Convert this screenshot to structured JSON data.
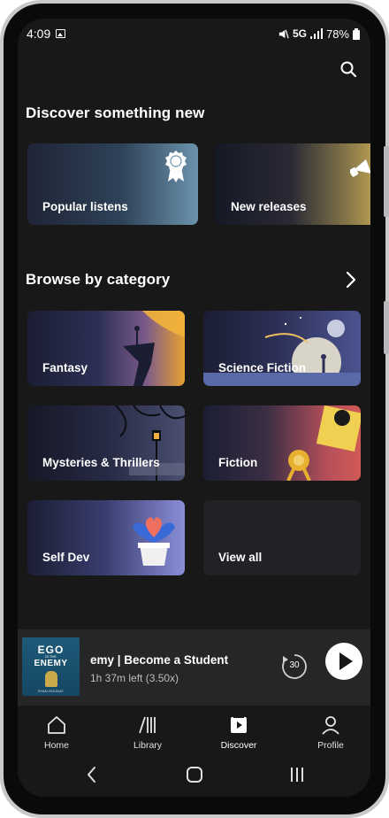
{
  "status": {
    "time": "4:09",
    "network": "5G",
    "battery": "78%"
  },
  "discover": {
    "title": "Discover something new",
    "cards": [
      {
        "label": "Popular listens"
      },
      {
        "label": "New releases"
      }
    ]
  },
  "browse": {
    "title": "Browse by category",
    "categories": [
      {
        "label": "Fantasy"
      },
      {
        "label": "Science Fiction"
      },
      {
        "label": "Mysteries & Thrillers"
      },
      {
        "label": "Fiction"
      },
      {
        "label": "Self Dev"
      },
      {
        "label": "View all"
      }
    ]
  },
  "mini_player": {
    "cover": {
      "line1": "EGO",
      "line2": "IS THE",
      "line3": "ENEMY",
      "author": "RYAN HOLIDAY"
    },
    "title": "emy | Become a Student",
    "subtitle": "1h 37m left (3.50x)",
    "rewind_seconds": "30"
  },
  "tabs": [
    {
      "label": "Home"
    },
    {
      "label": "Library"
    },
    {
      "label": "Discover"
    },
    {
      "label": "Profile"
    }
  ],
  "colors": {
    "background": "#181818",
    "player_bar": "#262626",
    "accent_gold": "#f0a020"
  }
}
